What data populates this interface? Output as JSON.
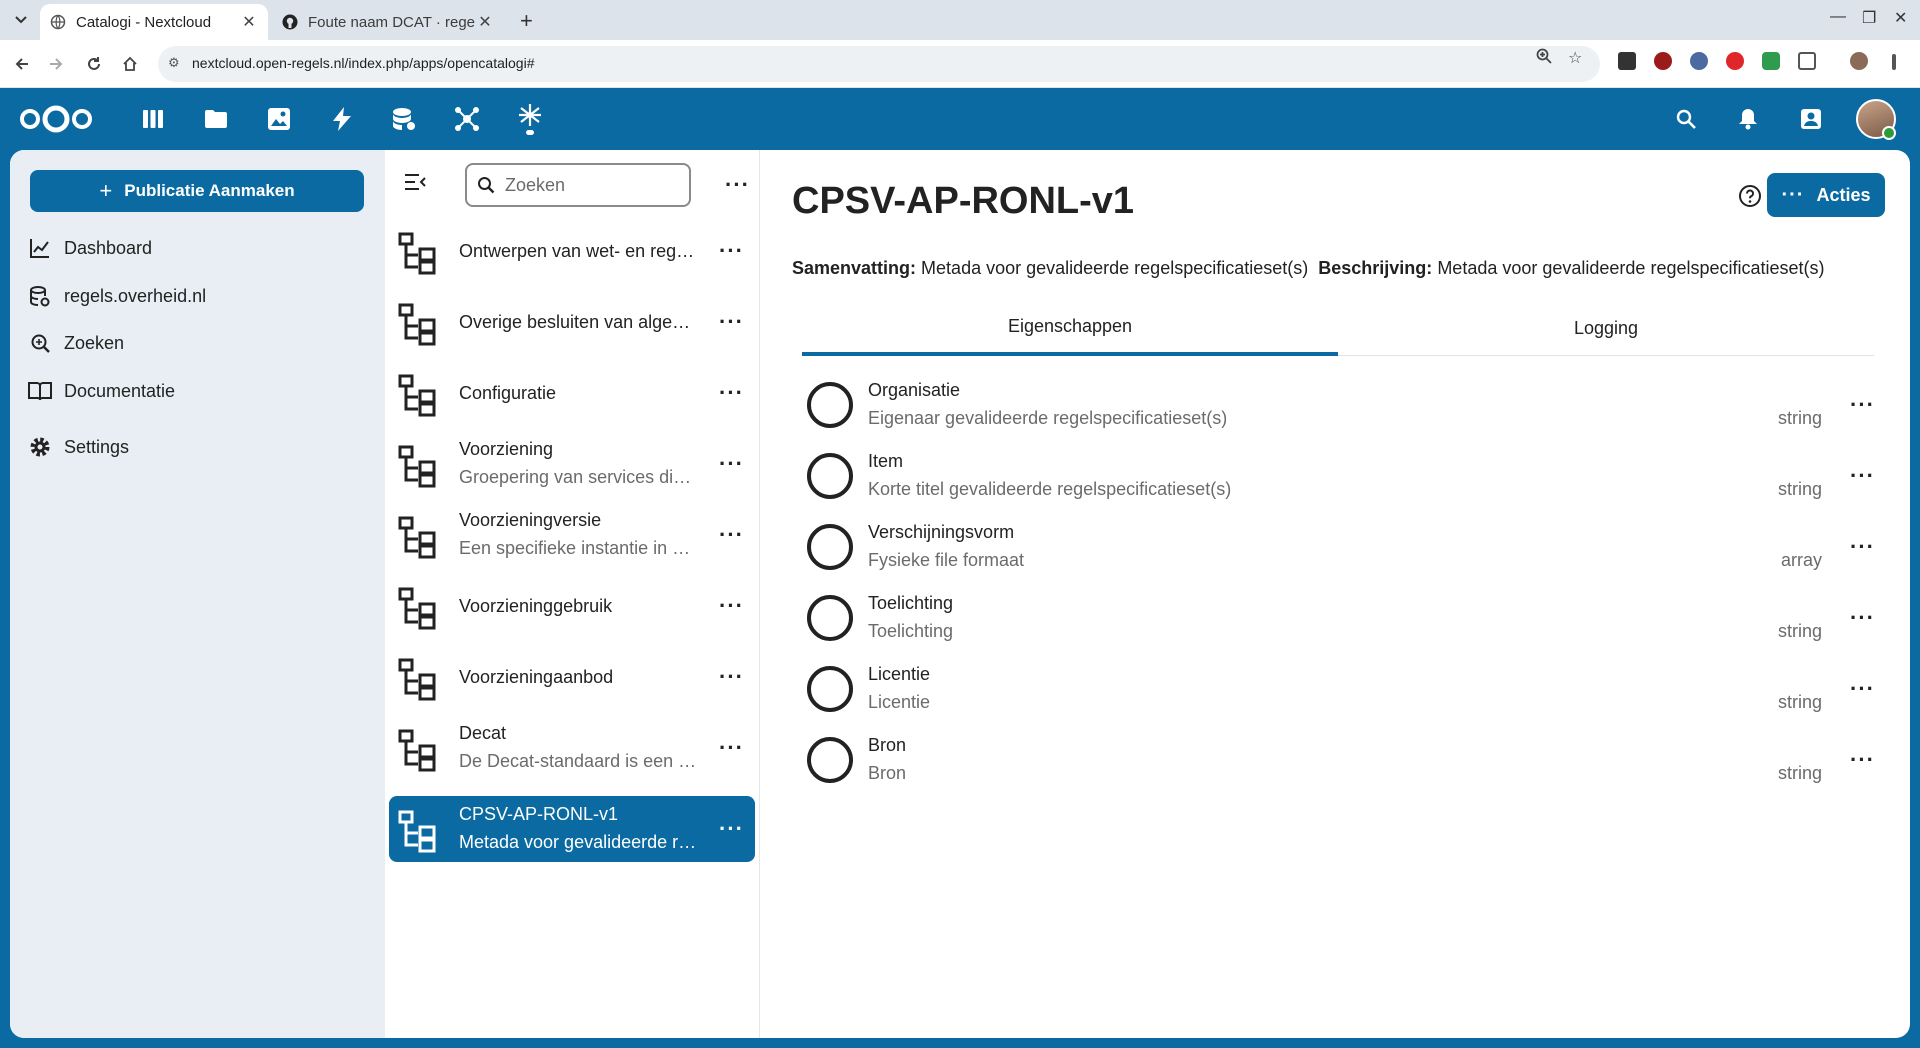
{
  "browser": {
    "tabs": [
      {
        "title": "Catalogi - Nextcloud",
        "active": true
      },
      {
        "title": "Foute naam DCAT · regel",
        "active": false
      }
    ],
    "url": "nextcloud.open-regels.nl/index.php/apps/opencatalogi#"
  },
  "colors": {
    "brand": "#0a6aa1",
    "sidebar_bg": "#e8eef3",
    "status_online": "#2d9b3a"
  },
  "leftnav": {
    "create_button": "Publicatie Aanmaken",
    "items": [
      {
        "label": "Dashboard",
        "icon": "chart-icon"
      },
      {
        "label": "regels.overheid.nl",
        "icon": "database-icon"
      },
      {
        "label": "Zoeken",
        "icon": "search-zoom-icon"
      },
      {
        "label": "Documentatie",
        "icon": "book-icon"
      },
      {
        "label": "Settings",
        "icon": "gear-icon"
      }
    ]
  },
  "list": {
    "search_placeholder": "Zoeken",
    "entries": [
      {
        "title": "Ontwerpen van wet- en regelgeving",
        "subtitle": ""
      },
      {
        "title": "Overige besluiten van algemene strekking",
        "subtitle": ""
      },
      {
        "title": "Configuratie",
        "subtitle": ""
      },
      {
        "title": "Voorziening",
        "subtitle": "Groepering van services die samen een voorziening vormen"
      },
      {
        "title": "Voorzieningversie",
        "subtitle": "Een specifieke instantie in de tijd van een voorziening"
      },
      {
        "title": "Voorzieninggebruik",
        "subtitle": ""
      },
      {
        "title": "Voorzieningaanbod",
        "subtitle": ""
      },
      {
        "title": "Decat",
        "subtitle": "De Decat-standaard is een uitbreiding"
      },
      {
        "title": "CPSV-AP-RONL-v1",
        "subtitle": "Metada voor gevalideerde regelspecificatieset(s)",
        "active": true
      }
    ]
  },
  "detail": {
    "title": "CPSV-AP-RONL-v1",
    "actions_label": "Acties",
    "summary_label": "Samenvatting:",
    "summary_value": "Metada voor gevalideerde regelspecificatieset(s)",
    "description_label": "Beschrijving:",
    "description_value": "Metada voor gevalideerde regelspecificatieset(s)",
    "tabs": [
      "Eigenschappen",
      "Logging"
    ],
    "properties": [
      {
        "name": "Organisatie",
        "description": "Eigenaar gevalideerde regelspecificatieset(s)",
        "type": "string"
      },
      {
        "name": "Item",
        "description": "Korte titel gevalideerde regelspecificatieset(s)",
        "type": "string"
      },
      {
        "name": "Verschijningsvorm",
        "description": "Fysieke file formaat",
        "type": "array"
      },
      {
        "name": "Toelichting",
        "description": "Toelichting",
        "type": "string"
      },
      {
        "name": "Licentie",
        "description": "Licentie",
        "type": "string"
      },
      {
        "name": "Bron",
        "description": "Bron",
        "type": "string"
      }
    ]
  }
}
